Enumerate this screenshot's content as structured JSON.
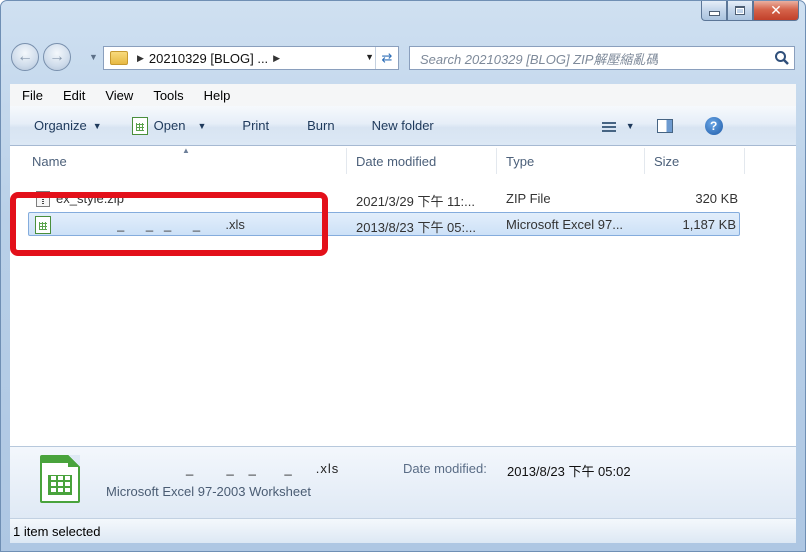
{
  "window": {
    "min_label": "–",
    "max_label": "□",
    "close_label": "✕"
  },
  "address": {
    "path": "20210329 [BLOG] ...",
    "search_placeholder": "Search 20210329 [BLOG] ZIP解壓縮亂碼"
  },
  "menu": [
    "File",
    "Edit",
    "View",
    "Tools",
    "Help"
  ],
  "commands": {
    "organize": "Organize",
    "open": "Open",
    "print": "Print",
    "burn": "Burn",
    "new_folder": "New folder"
  },
  "columns": {
    "name": "Name",
    "date": "Date modified",
    "type": "Type",
    "size": "Size"
  },
  "files": [
    {
      "name": "ex_style.zip",
      "date": "2021/3/29 下午 11:...",
      "type": "ZIP File",
      "size": "320 KB"
    },
    {
      "name": "_      _   _      _       .xls",
      "date": "2013/8/23 下午 05:...",
      "type": "Microsoft Excel 97...",
      "size": "1,187 KB"
    }
  ],
  "details": {
    "name": "_       _   _      _     .xls",
    "date_label": "Date modified:",
    "date_value": "2013/8/23 下午 05:02",
    "type": "Microsoft Excel 97-2003 Worksheet"
  },
  "status": "1 item selected",
  "colors": {
    "highlight": "#e3101a",
    "selection": "#cde1f7"
  }
}
